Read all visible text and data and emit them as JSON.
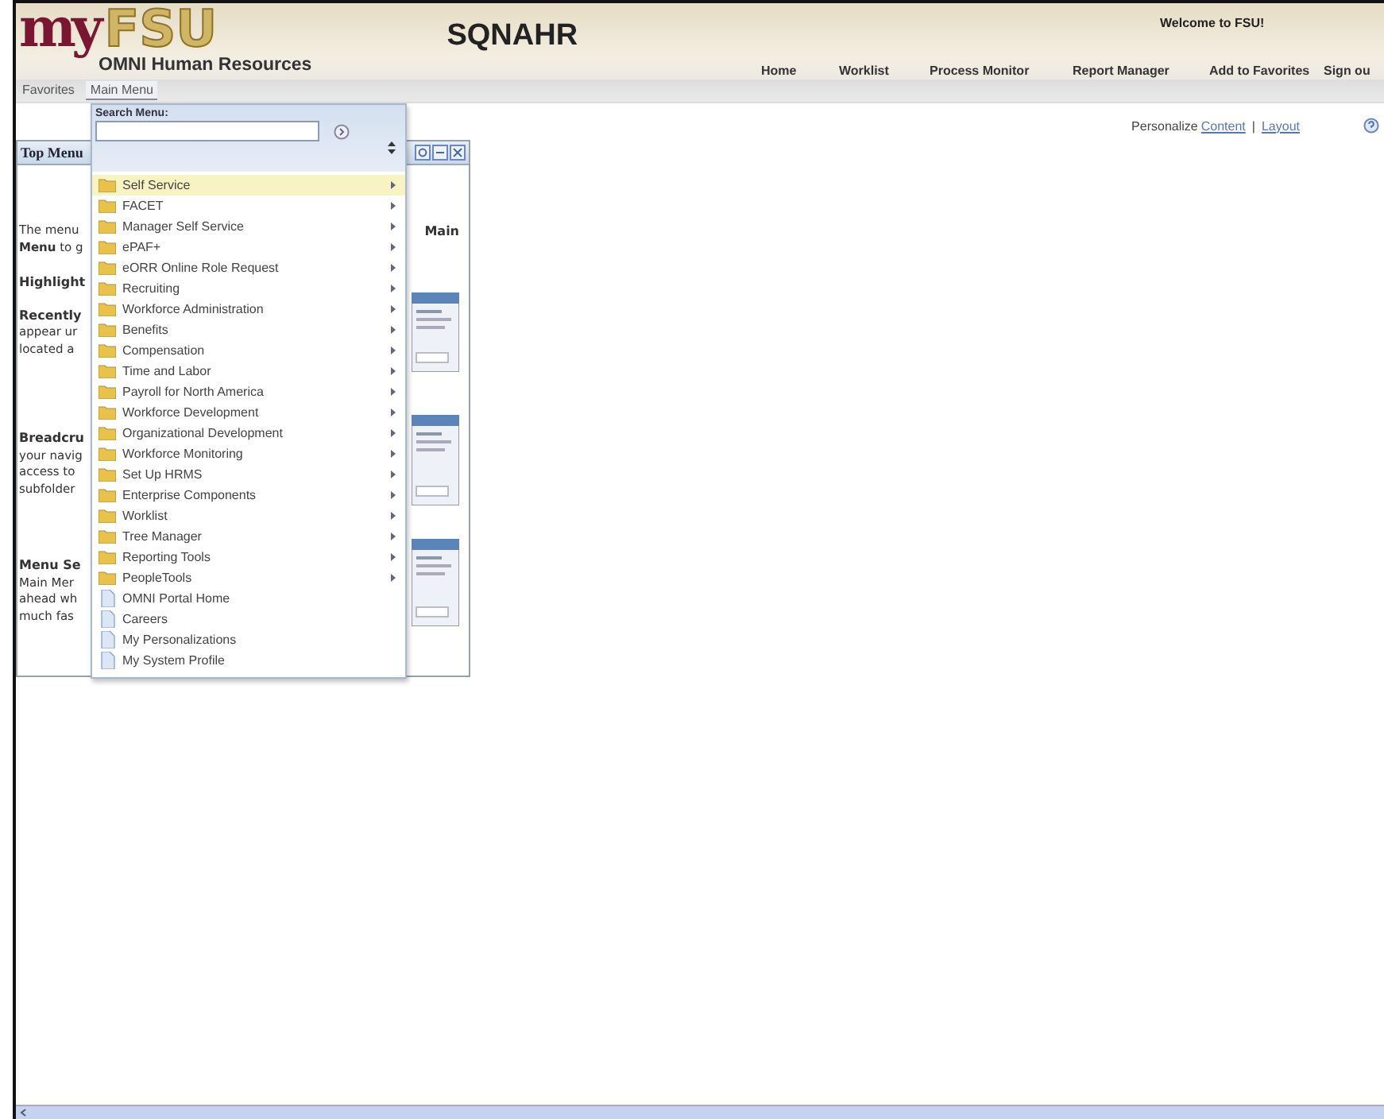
{
  "header": {
    "logo": {
      "prefix": "my",
      "name": "FSU"
    },
    "subtitle": "OMNI Human Resources",
    "system": "SQNAHR",
    "welcome": "Welcome to FSU!"
  },
  "nav_links": [
    "Home",
    "Worklist",
    "Process Monitor",
    "Report Manager",
    "Add to Favorites",
    "Sign ou"
  ],
  "menubar": [
    {
      "label": "Favorites",
      "selected": false
    },
    {
      "label": "Main Menu",
      "selected": true
    }
  ],
  "personalize": {
    "label": "Personalize",
    "links": [
      "Content",
      "Layout"
    ],
    "separator": "|"
  },
  "pagelet": {
    "title": "Top Menu",
    "left_blocks": [
      {
        "lines": [
          {
            "text": "The menu",
            "kind": "text"
          },
          {
            "text": "**Menu** to g",
            "kind": "text"
          }
        ]
      },
      {
        "lines": [
          {
            "text": "Highlight",
            "kind": "heading"
          }
        ]
      },
      {
        "lines": [
          {
            "text": "Recently",
            "kind": "heading"
          },
          {
            "text": "appear ur",
            "kind": "text"
          },
          {
            "text": "located a",
            "kind": "text"
          }
        ]
      },
      {
        "lines": [
          {
            "text": "Breadcru",
            "kind": "heading"
          },
          {
            "text": "your navig",
            "kind": "text"
          },
          {
            "text": "access to",
            "kind": "text"
          },
          {
            "text": "subfolder",
            "kind": "text"
          }
        ]
      },
      {
        "lines": [
          {
            "text": "Menu Se",
            "kind": "heading"
          },
          {
            "text": "Main Mer",
            "kind": "text"
          },
          {
            "text": "ahead wh",
            "kind": "text"
          },
          {
            "text": "much fas",
            "kind": "text"
          }
        ]
      }
    ],
    "right_text": "Main"
  },
  "main_menu": {
    "search_label": "Search Menu:",
    "items": [
      {
        "label": "Self Service",
        "kind": "folder",
        "selected": true
      },
      {
        "label": "FACET",
        "kind": "folder",
        "selected": false
      },
      {
        "label": "Manager Self Service",
        "kind": "folder",
        "selected": false
      },
      {
        "label": "ePAF+",
        "kind": "folder",
        "selected": false
      },
      {
        "label": "eORR Online Role Request",
        "kind": "folder",
        "selected": false
      },
      {
        "label": "Recruiting",
        "kind": "folder",
        "selected": false
      },
      {
        "label": "Workforce Administration",
        "kind": "folder",
        "selected": false
      },
      {
        "label": "Benefits",
        "kind": "folder",
        "selected": false
      },
      {
        "label": "Compensation",
        "kind": "folder",
        "selected": false
      },
      {
        "label": "Time and Labor",
        "kind": "folder",
        "selected": false
      },
      {
        "label": "Payroll for North America",
        "kind": "folder",
        "selected": false
      },
      {
        "label": "Workforce Development",
        "kind": "folder",
        "selected": false
      },
      {
        "label": "Organizational Development",
        "kind": "folder",
        "selected": false
      },
      {
        "label": "Workforce Monitoring",
        "kind": "folder",
        "selected": false
      },
      {
        "label": "Set Up HRMS",
        "kind": "folder",
        "selected": false
      },
      {
        "label": "Enterprise Components",
        "kind": "folder",
        "selected": false
      },
      {
        "label": "Worklist",
        "kind": "folder",
        "selected": false
      },
      {
        "label": "Tree Manager",
        "kind": "folder",
        "selected": false
      },
      {
        "label": "Reporting Tools",
        "kind": "folder",
        "selected": false
      },
      {
        "label": "PeopleTools",
        "kind": "folder",
        "selected": false
      },
      {
        "label": "OMNI Portal Home",
        "kind": "page",
        "selected": false
      },
      {
        "label": "Careers",
        "kind": "page",
        "selected": false
      },
      {
        "label": "My Personalizations",
        "kind": "page",
        "selected": false
      },
      {
        "label": "My System Profile",
        "kind": "page",
        "selected": false
      }
    ]
  }
}
